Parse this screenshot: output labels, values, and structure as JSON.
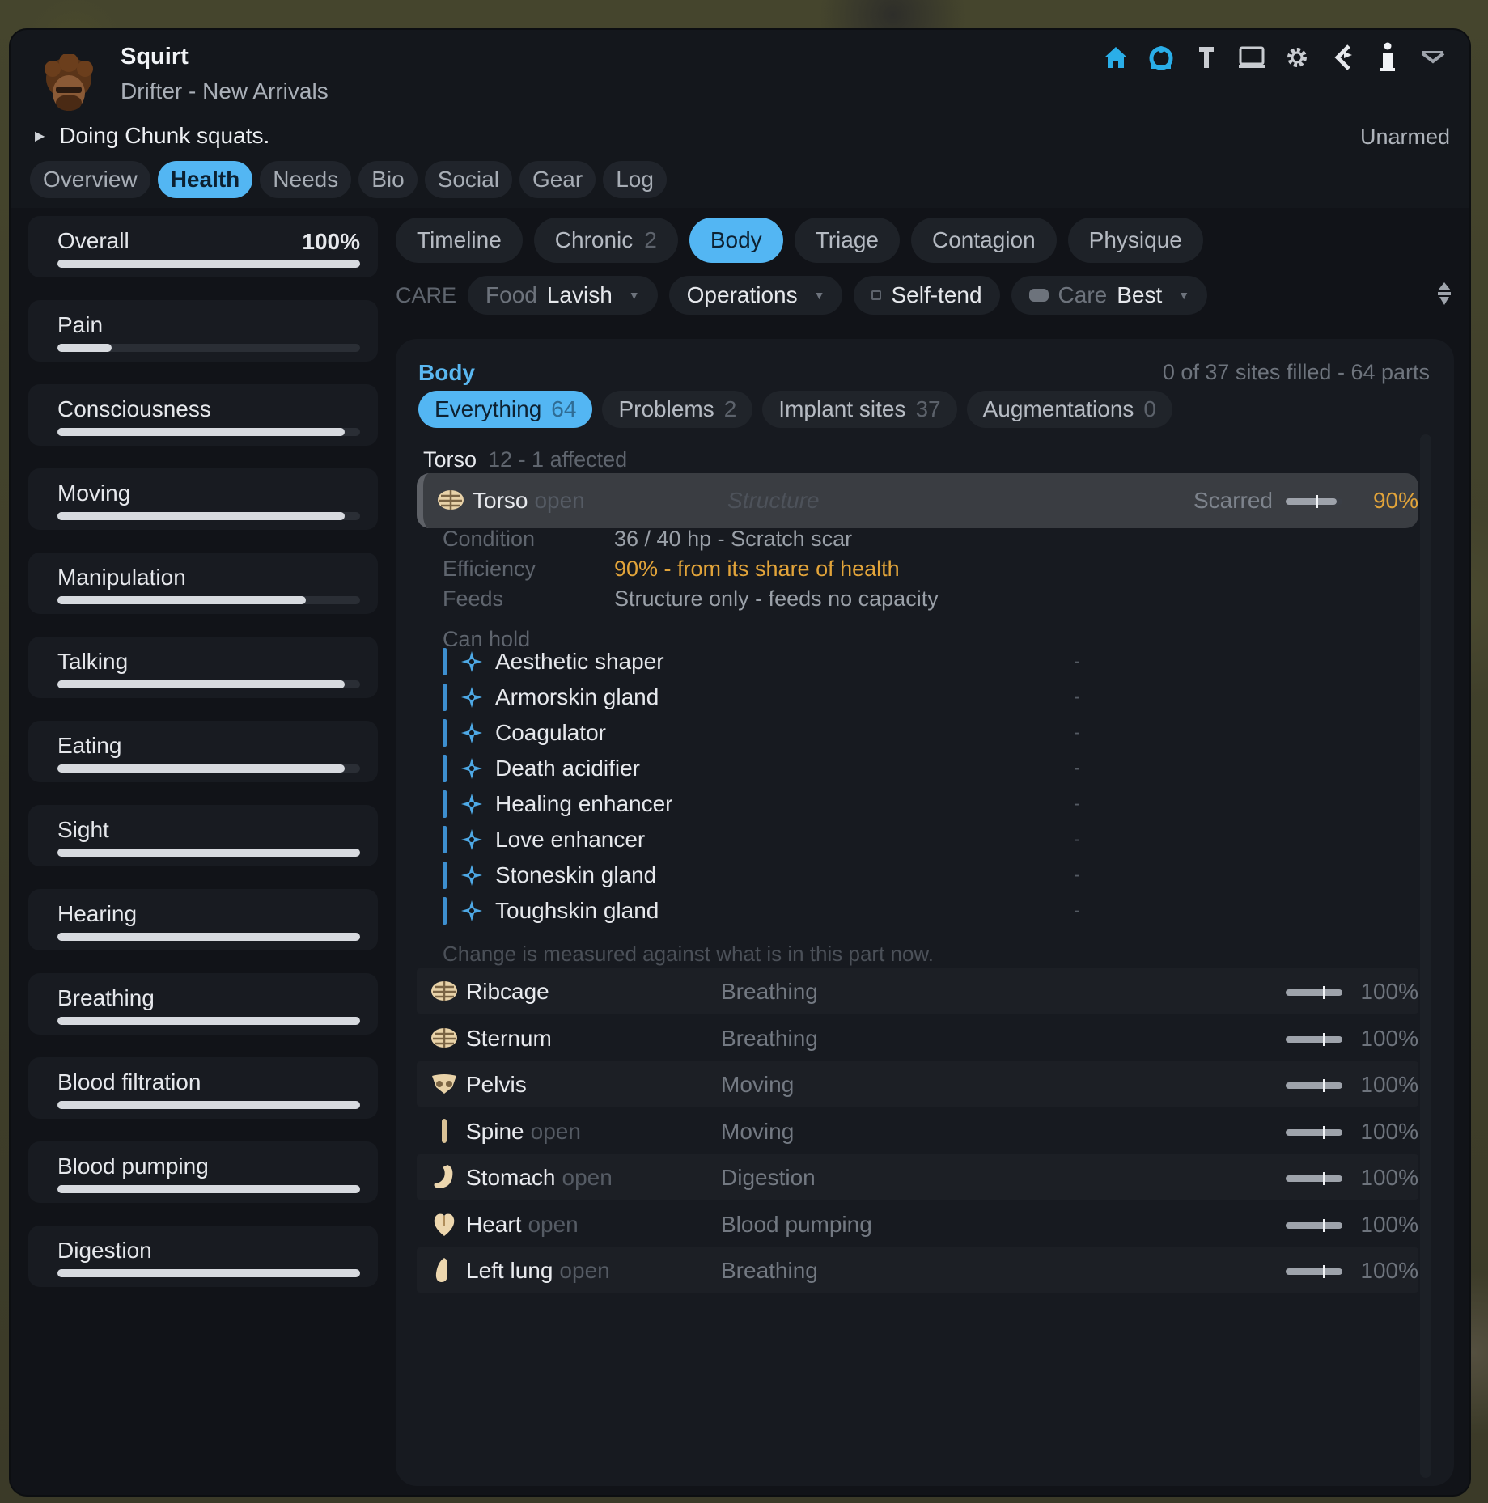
{
  "pawn": {
    "name": "Squirt",
    "subtitle": "Drifter - New Arrivals",
    "activity": "Doing Chunk squats.",
    "weapon": "Unarmed"
  },
  "toolbar": {
    "icons": [
      "home-icon",
      "faction-icon",
      "pin-icon",
      "laptop-icon",
      "gear-icon",
      "kirby-icon",
      "info-icon",
      "chevron-down-icon"
    ]
  },
  "main_tabs": [
    {
      "label": "Overview"
    },
    {
      "label": "Health",
      "active": true
    },
    {
      "label": "Needs"
    },
    {
      "label": "Bio"
    },
    {
      "label": "Social"
    },
    {
      "label": "Gear"
    },
    {
      "label": "Log"
    }
  ],
  "capacities": [
    {
      "label": "Overall",
      "value": "100%",
      "fill": 1.0
    },
    {
      "label": "Pain",
      "value": "",
      "fill": 0.18
    },
    {
      "label": "Consciousness",
      "value": "",
      "fill": 0.95
    },
    {
      "label": "Moving",
      "value": "",
      "fill": 0.95
    },
    {
      "label": "Manipulation",
      "value": "",
      "fill": 0.82
    },
    {
      "label": "Talking",
      "value": "",
      "fill": 0.95
    },
    {
      "label": "Eating",
      "value": "",
      "fill": 0.95
    },
    {
      "label": "Sight",
      "value": "",
      "fill": 1.0
    },
    {
      "label": "Hearing",
      "value": "",
      "fill": 1.0
    },
    {
      "label": "Breathing",
      "value": "",
      "fill": 1.0
    },
    {
      "label": "Blood filtration",
      "value": "",
      "fill": 1.0
    },
    {
      "label": "Blood pumping",
      "value": "",
      "fill": 1.0
    },
    {
      "label": "Digestion",
      "value": "",
      "fill": 1.0
    }
  ],
  "sub_tabs": [
    {
      "label": "Timeline",
      "count": ""
    },
    {
      "label": "Chronic",
      "count": "2"
    },
    {
      "label": "Body",
      "count": "",
      "active": true
    },
    {
      "label": "Triage",
      "count": ""
    },
    {
      "label": "Contagion",
      "count": ""
    },
    {
      "label": "Physique",
      "count": ""
    }
  ],
  "care": {
    "label": "CARE",
    "food_key": "Food",
    "food_val": "Lavish",
    "operations": "Operations",
    "selftend": "Self-tend",
    "care_key": "Care",
    "care_val": "Best"
  },
  "body_panel": {
    "title": "Body",
    "status": "0 of 37 sites filled - 64 parts",
    "filters": [
      {
        "label": "Everything",
        "count": "64",
        "active": true
      },
      {
        "label": "Problems",
        "count": "2"
      },
      {
        "label": "Implant sites",
        "count": "37"
      },
      {
        "label": "Augmentations",
        "count": "0"
      }
    ],
    "group": {
      "name": "Torso",
      "sub": "12 - 1 affected"
    },
    "selected": {
      "name": "Torso",
      "open": "open",
      "function": "Structure",
      "state": "Scarred",
      "percent": "90%",
      "level": 0.9
    },
    "details": {
      "condition_key": "Condition",
      "condition_val": "36 / 40 hp - Scratch scar",
      "efficiency_key": "Efficiency",
      "efficiency_val": "90%  - from its share of health",
      "feeds_key": "Feeds",
      "feeds_val": "Structure only - feeds no capacity",
      "can_hold": "Can hold"
    },
    "implants": [
      {
        "name": "Aesthetic shaper",
        "delta": "-"
      },
      {
        "name": "Armorskin gland",
        "delta": "-"
      },
      {
        "name": "Coagulator",
        "delta": "-"
      },
      {
        "name": "Death acidifier",
        "delta": "-"
      },
      {
        "name": "Healing enhancer",
        "delta": "-"
      },
      {
        "name": "Love enhancer",
        "delta": "-"
      },
      {
        "name": "Stoneskin gland",
        "delta": "-"
      },
      {
        "name": "Toughskin gland",
        "delta": "-"
      }
    ],
    "note": "Change is measured against what is in this part now.",
    "parts": [
      {
        "name": "Ribcage",
        "open": "",
        "function": "Breathing",
        "percent": "100%",
        "icon": "ribcage-icon",
        "level": 1.0
      },
      {
        "name": "Sternum",
        "open": "",
        "function": "Breathing",
        "percent": "100%",
        "icon": "ribcage-icon",
        "level": 1.0
      },
      {
        "name": "Pelvis",
        "open": "",
        "function": "Moving",
        "percent": "100%",
        "icon": "pelvis-icon",
        "level": 1.0
      },
      {
        "name": "Spine",
        "open": "open",
        "function": "Moving",
        "percent": "100%",
        "icon": "spine-icon",
        "level": 1.0
      },
      {
        "name": "Stomach",
        "open": "open",
        "function": "Digestion",
        "percent": "100%",
        "icon": "stomach-icon",
        "level": 1.0
      },
      {
        "name": "Heart",
        "open": "open",
        "function": "Blood pumping",
        "percent": "100%",
        "icon": "heart-icon",
        "level": 1.0
      },
      {
        "name": "Left lung",
        "open": "open",
        "function": "Breathing",
        "percent": "100%",
        "icon": "lung-icon",
        "level": 1.0
      }
    ]
  },
  "colors": {
    "accent": "#53b6f3",
    "warn": "#e2a43a",
    "panel": "#171a20"
  }
}
